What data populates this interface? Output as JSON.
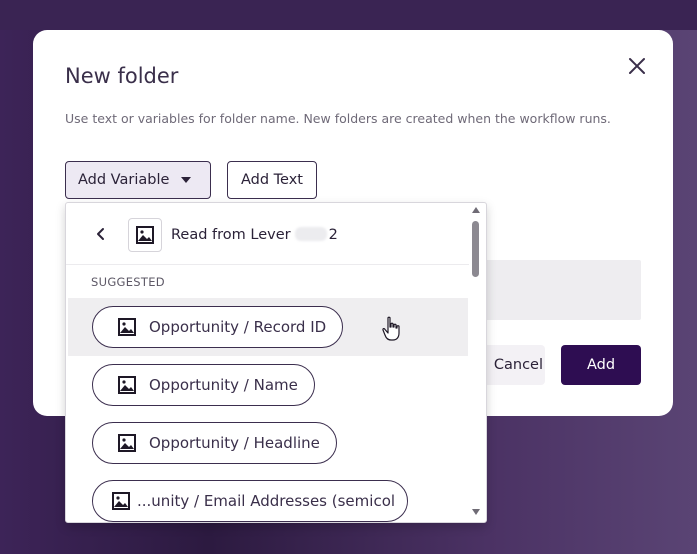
{
  "modal": {
    "title": "New folder",
    "description": "Use text or variables for folder name. New folders are created when the workflow runs.",
    "add_variable_label": "Add Variable",
    "add_text_label": "Add Text",
    "cancel_label": "Cancel",
    "add_label": "Add"
  },
  "dropdown": {
    "source_prefix": "Read from Lever",
    "source_suffix": "2",
    "section_label": "SUGGESTED",
    "items": [
      {
        "label": "Opportunity / Record ID",
        "icon": "image-icon"
      },
      {
        "label": "Opportunity / Name",
        "icon": "image-icon"
      },
      {
        "label": "Opportunity / Headline",
        "icon": "image-icon"
      },
      {
        "label": "...unity / Email Addresses (semicol",
        "icon": "image-icon"
      }
    ]
  },
  "colors": {
    "primary": "#2e0d52",
    "overlay": "#3d2458",
    "hover_row": "#efeef0"
  }
}
